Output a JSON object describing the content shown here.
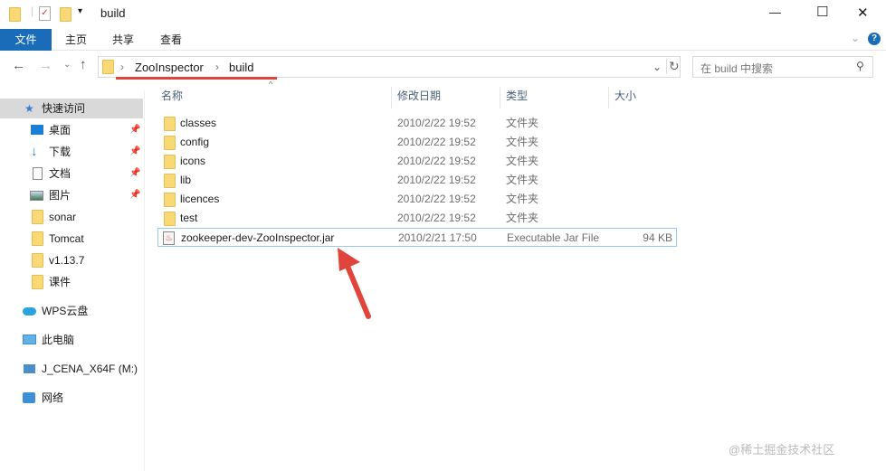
{
  "window": {
    "title": "build",
    "minimize": "—",
    "maximize": "☐",
    "close": "✕"
  },
  "ribbon": {
    "tabs": [
      "文件",
      "主页",
      "共享",
      "查看"
    ],
    "help": "?",
    "expand": "⌄"
  },
  "nav": {
    "back": "←",
    "forward": "→",
    "recent": "⌄",
    "up": "↑"
  },
  "address": {
    "crumbs": [
      "ZooInspector",
      "build"
    ],
    "sep": "›",
    "dropdown": "⌄",
    "refresh": "↻"
  },
  "search": {
    "placeholder": "在 build 中搜索",
    "icon": "⚲"
  },
  "sidebar": {
    "quick_access": "快速访问",
    "pinned": [
      {
        "label": "桌面"
      },
      {
        "label": "下载"
      },
      {
        "label": "文档"
      },
      {
        "label": "图片"
      }
    ],
    "folders": [
      "sonar",
      "Tomcat",
      "v1.13.7",
      "课件"
    ],
    "wps": "WPS云盘",
    "pc": "此电脑",
    "drive": "J_CENA_X64F (M:)",
    "network": "网络"
  },
  "columns": {
    "name": "名称",
    "date": "修改日期",
    "type": "类型",
    "size": "大小"
  },
  "files": [
    {
      "name": "classes",
      "date": "2010/2/22 19:52",
      "type": "文件夹",
      "size": ""
    },
    {
      "name": "config",
      "date": "2010/2/22 19:52",
      "type": "文件夹",
      "size": ""
    },
    {
      "name": "icons",
      "date": "2010/2/22 19:52",
      "type": "文件夹",
      "size": ""
    },
    {
      "name": "lib",
      "date": "2010/2/22 19:52",
      "type": "文件夹",
      "size": ""
    },
    {
      "name": "licences",
      "date": "2010/2/22 19:52",
      "type": "文件夹",
      "size": ""
    },
    {
      "name": "test",
      "date": "2010/2/22 19:52",
      "type": "文件夹",
      "size": ""
    },
    {
      "name": "zookeeper-dev-ZooInspector.jar",
      "date": "2010/2/21 17:50",
      "type": "Executable Jar File",
      "size": "94 KB"
    }
  ],
  "watermark": "@稀土掘金技术社区",
  "colors": {
    "accent": "#1a6bb8",
    "annotation": "#e0443a"
  }
}
